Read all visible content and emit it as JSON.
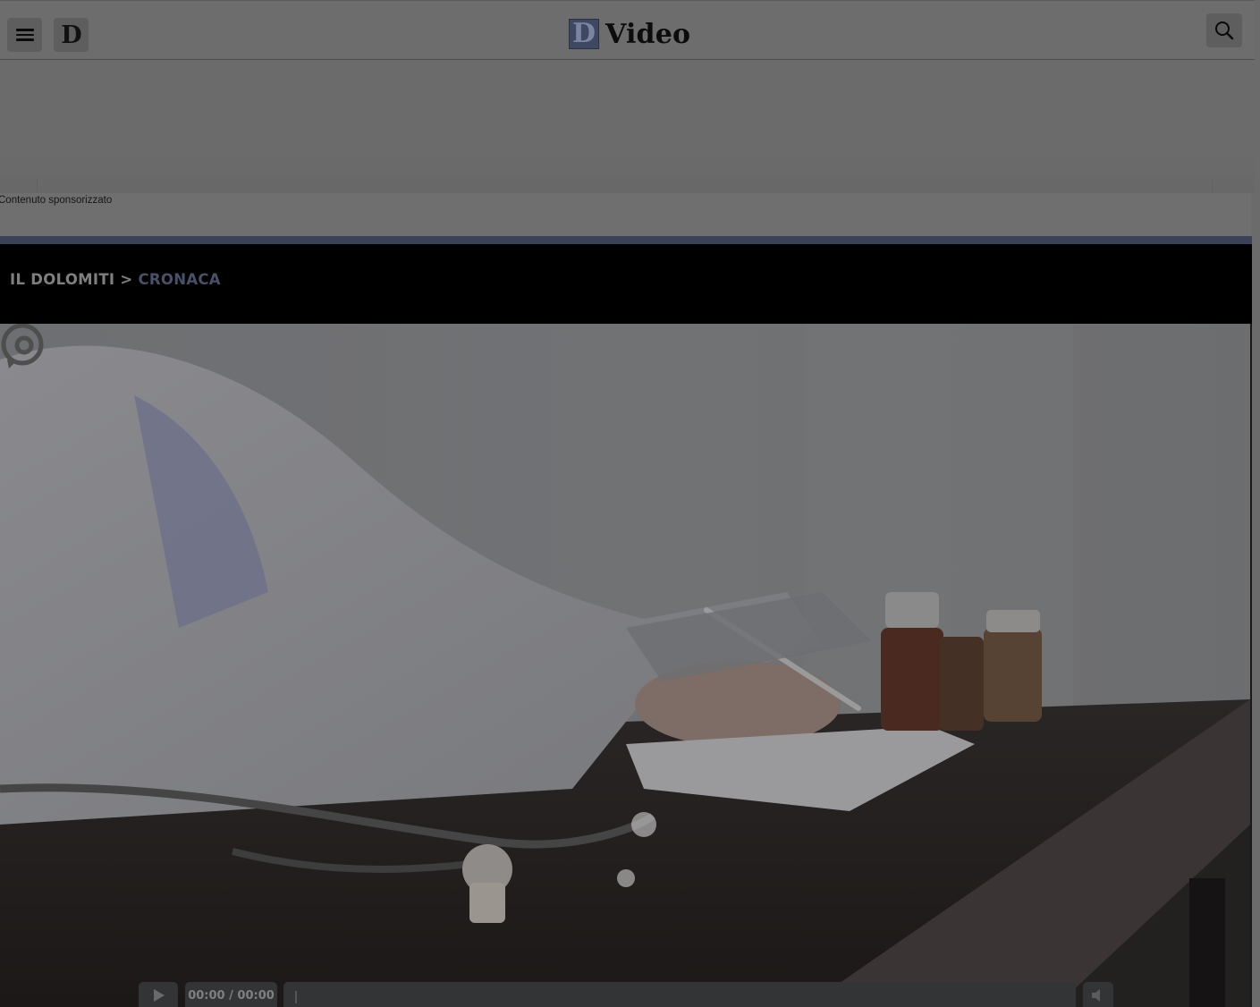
{
  "header": {
    "menu_icon": "hamburger-menu-icon",
    "site_logo_letter": "D",
    "brand_logo_letter": "D",
    "brand_title": "Video",
    "search_icon": "search-icon"
  },
  "ad": {
    "sponsored_label": "Contenuto sponsorizzato"
  },
  "breadcrumb": {
    "home": "IL DOLOMITI",
    "separator": ">",
    "current": "CRONACA"
  },
  "player": {
    "time": "00:00 / 00:00",
    "progress": 0,
    "play_icon": "play-icon",
    "mute_icon": "speaker-icon",
    "watermark_icon": "at-sign-icon"
  },
  "colors": {
    "accent": "#3b4257",
    "breadcrumb_current": "#4a5068",
    "band": "#000000"
  }
}
